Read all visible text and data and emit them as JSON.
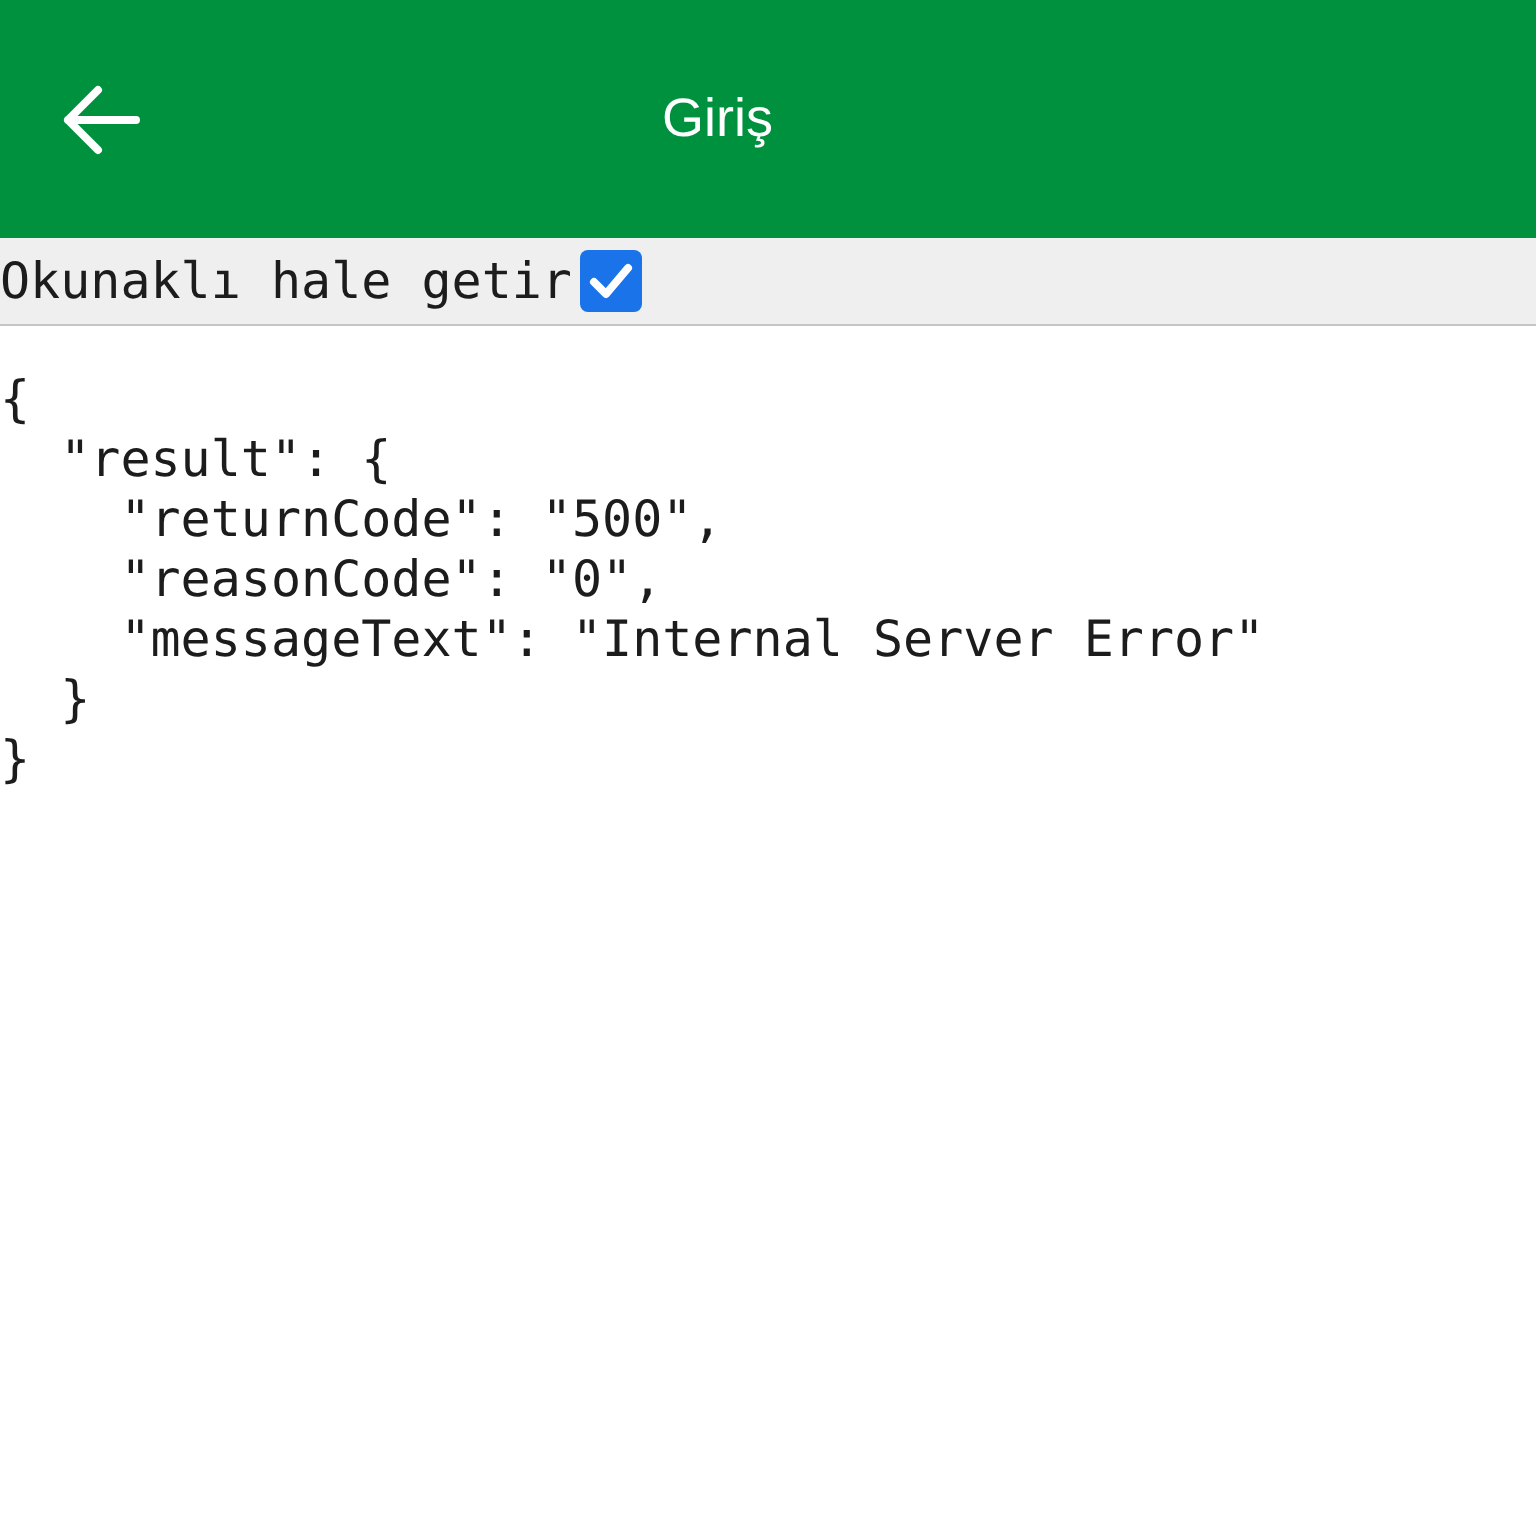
{
  "app_bar": {
    "title": "Giriş"
  },
  "readable_toggle": {
    "label": "Okunaklı hale getir",
    "checked": true
  },
  "response_lines": [
    "{",
    "  \"result\": {",
    "    \"returnCode\": \"500\",",
    "    \"reasonCode\": \"0\",",
    "    \"messageText\": \"Internal Server Error\"",
    "  }",
    "}"
  ]
}
